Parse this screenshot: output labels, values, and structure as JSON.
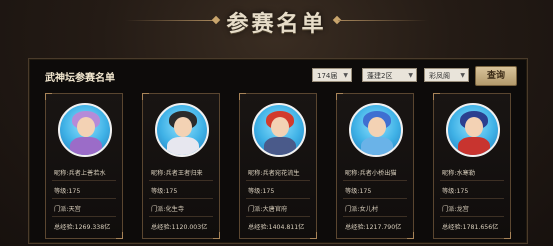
{
  "page": {
    "title": "参赛名单"
  },
  "panel": {
    "title": "武神坛参赛名单",
    "filters": [
      {
        "value": "174届"
      },
      {
        "value": "蓬建2区"
      },
      {
        "value": "彩凤阁"
      }
    ],
    "query_label": "查询"
  },
  "players": [
    {
      "name_line": "昵称:兵者上善若水",
      "level_line": "等级:175",
      "school_line": "门派:天宫",
      "score_line": "总经验:1269.338亿",
      "hair_color": "#b58bd8",
      "body_color": "#9b6cc8"
    },
    {
      "name_line": "昵称:兵者王者归来",
      "level_line": "等级:175",
      "school_line": "门派:化生寺",
      "score_line": "总经验:1120.003亿",
      "hair_color": "#2b2b2b",
      "body_color": "#e7e7ef"
    },
    {
      "name_line": "昵称:兵者宛花流生",
      "level_line": "等级:175",
      "school_line": "门派:大唐官府",
      "score_line": "总经验:1404.811亿",
      "hair_color": "#d23b2d",
      "body_color": "#4a5a8a"
    },
    {
      "name_line": "昵称:兵者小桥出猫",
      "level_line": "等级:175",
      "school_line": "门派:女儿村",
      "score_line": "总经验:1217.790亿",
      "hair_color": "#3f6fd1",
      "body_color": "#6ab3e8"
    },
    {
      "name_line": "昵称:水寒勒",
      "level_line": "等级:175",
      "school_line": "门派:龙宫",
      "score_line": "总经验:1781.656亿",
      "hair_color": "#2b3f8f",
      "body_color": "#c8342f"
    }
  ]
}
